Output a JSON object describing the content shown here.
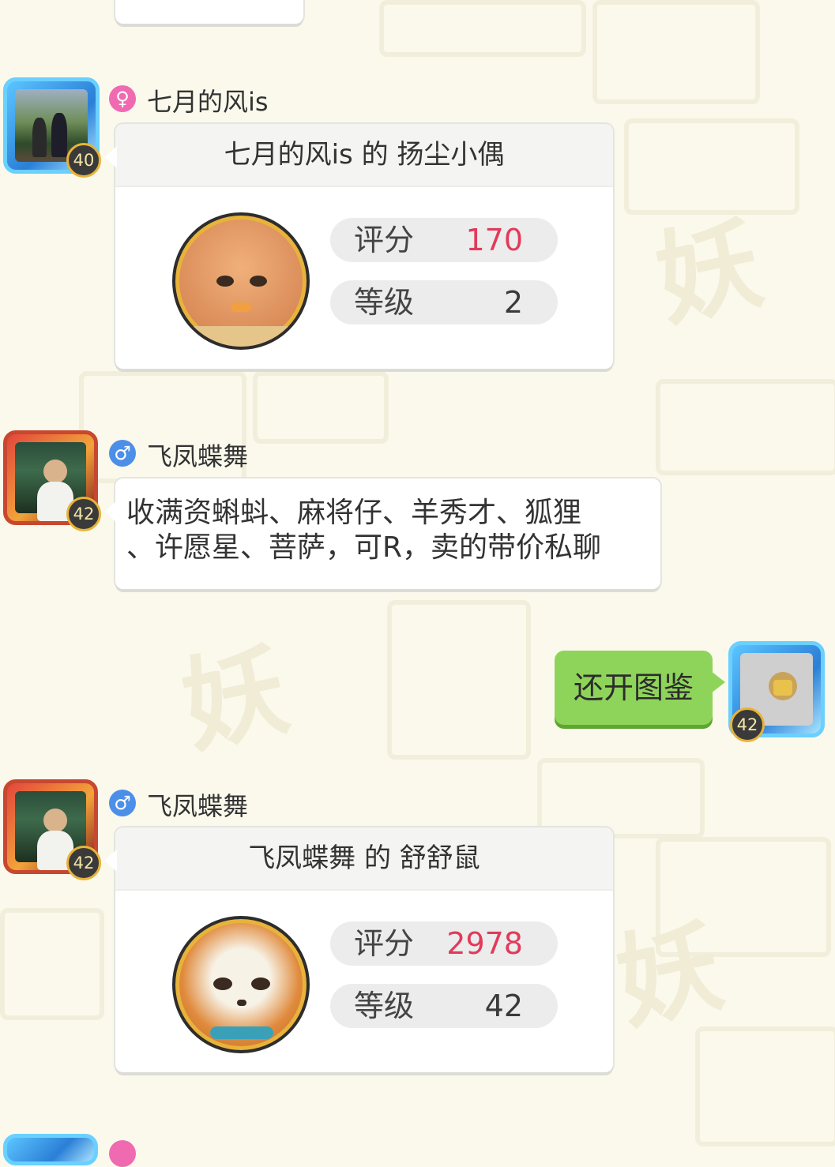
{
  "messages": [
    {
      "type": "pet-card",
      "user": {
        "name": "七月的风is",
        "gender": "female",
        "gender_symbol": "♀",
        "level": "40"
      },
      "card": {
        "title": "七月的风is 的 扬尘小偶",
        "score_label": "评分",
        "score": "170",
        "level_label": "等级",
        "level": "2"
      }
    },
    {
      "type": "text",
      "user": {
        "name": "飞凤蝶舞",
        "gender": "male",
        "gender_symbol": "♂",
        "level": "42"
      },
      "text_lines": [
        "收满资蝌蚪、麻将仔、羊秀才、狐狸",
        "、许愿星、菩萨，可R，卖的带价私聊"
      ]
    },
    {
      "type": "self-text",
      "user": {
        "level": "42"
      },
      "text": "还开图鉴"
    },
    {
      "type": "pet-card",
      "user": {
        "name": "飞凤蝶舞",
        "gender": "male",
        "gender_symbol": "♂",
        "level": "42"
      },
      "card": {
        "title": "飞凤蝶舞 的 舒舒鼠",
        "score_label": "评分",
        "score": "2978",
        "level_label": "等级",
        "level": "42"
      }
    }
  ],
  "colors": {
    "accent_green": "#8fd45a",
    "score_red": "#e23a5a",
    "female": "#f06ab2",
    "male": "#4c8fe8"
  }
}
